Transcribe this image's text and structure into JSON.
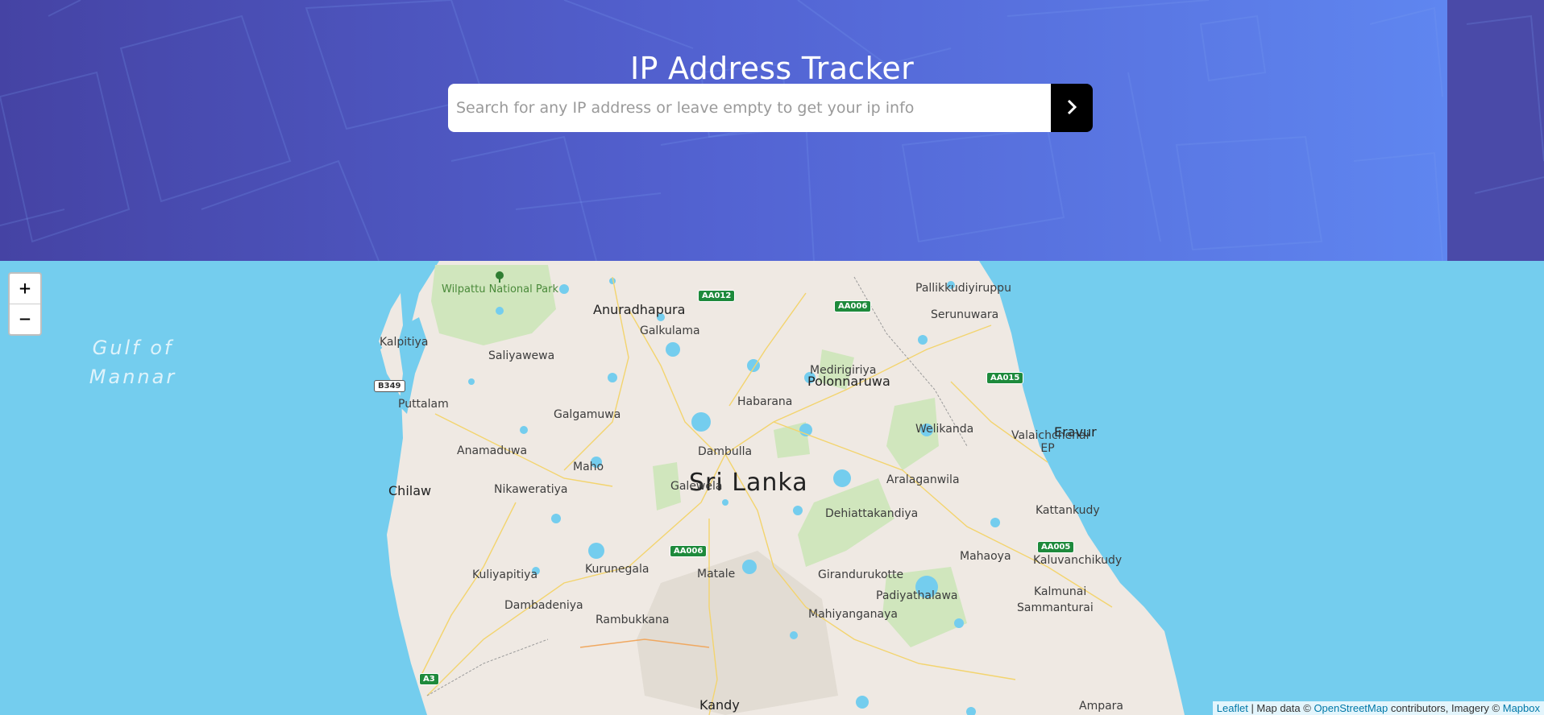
{
  "header": {
    "title": "IP Address Tracker",
    "search_placeholder": "Search for any IP address or leave empty to get your ip info",
    "search_value": "",
    "submit_icon": "chevron-right-icon"
  },
  "map": {
    "zoom_in": "+",
    "zoom_out": "−",
    "country_label": "Sri Lanka",
    "sea_label": "Gulf of Mannar",
    "park_label": "Wilpattu National Park",
    "park_icon": "tree-icon",
    "city_labels": [
      "Anuradhapura",
      "Polonnaruwa",
      "Chilaw",
      "Eravur",
      "Kandy"
    ],
    "town_labels": [
      "Pallikkudiyiruppu",
      "Serunuwara",
      "Galkulama",
      "Kalpitiya",
      "Saliyawewa",
      "Medirigiriya",
      "Puttalam",
      "Habarana",
      "Galgamuwa",
      "Welikanda",
      "Valaichchenai EP",
      "Anamaduwa",
      "Dambulla",
      "Maho",
      "Aralaganwila",
      "Nikaweratiya",
      "Galewela",
      "Kattankudy",
      "Dehiattakandiya",
      "Mahaoya",
      "Kurunegala",
      "Kaluvanchikudy",
      "Kuliyapitiya",
      "Matale",
      "Girandurukotte",
      "Kalmunai",
      "Padiyathalawa",
      "Dambadeniya",
      "Sammanturai",
      "Rambukkana",
      "Mahiyanganaya",
      "Ampara"
    ],
    "road_shields": [
      "AA012",
      "AA006",
      "AA015",
      "B349",
      "AA006",
      "AA005",
      "A3"
    ],
    "attribution": {
      "leaflet": "Leaflet",
      "map_data": " | Map data © ",
      "osm": "OpenStreetMap",
      "contrib": " contributors, Imagery © ",
      "mapbox": "Mapbox"
    }
  }
}
